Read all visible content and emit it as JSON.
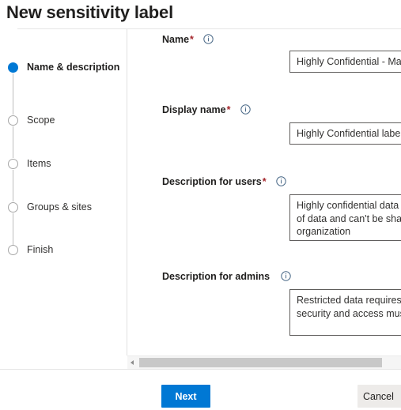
{
  "page_title": "New sensitivity label",
  "wizard": {
    "steps": [
      {
        "label": "Name & description",
        "state": "active"
      },
      {
        "label": "Scope",
        "state": "inactive"
      },
      {
        "label": "Items",
        "state": "inactive"
      },
      {
        "label": "Groups & sites",
        "state": "inactive"
      },
      {
        "label": "Finish",
        "state": "inactive"
      }
    ]
  },
  "form": {
    "name": {
      "label": "Name",
      "required": "*",
      "info_icon": "info-circle-icon",
      "value": "Highly Confidential - Marketing Team",
      "placeholder": ""
    },
    "display_name": {
      "label": "Display name",
      "required": "*",
      "info_icon": "info-circle-icon",
      "value": "Highly Confidential label",
      "placeholder": ""
    },
    "description_users": {
      "label": "Description for users",
      "required": "*",
      "info_icon": "info-circle-icon",
      "value": "Highly confidential data is the most sensitive type of data and can't be shared outside the organization",
      "placeholder": ""
    },
    "description_admins": {
      "label": "Description for admins",
      "required": "",
      "info_icon": "info-circle-icon",
      "value": "Restricted data requires the highest level of security and access must be limited",
      "placeholder": ""
    }
  },
  "scrollbar": {
    "left_arrow_icon": "caret-left-icon",
    "orientation": "horizontal"
  },
  "footer": {
    "next_label": "Next",
    "cancel_label": "Cancel"
  },
  "colors": {
    "accent": "#0078d4",
    "required_asterisk": "#a4262c",
    "step_inactive": "#a6a6a6",
    "input_border": "#605e5c",
    "cancel_bg": "#edebe9",
    "scrollbar_thumb": "#c8c8c8"
  }
}
